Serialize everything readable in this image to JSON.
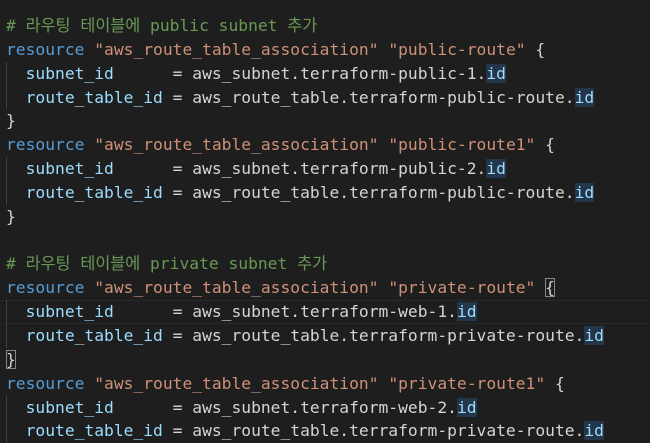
{
  "colors": {
    "background": "#1e1e1e",
    "comment": "#6a9955",
    "keyword": "#569cd6",
    "string": "#ce9178",
    "attribute": "#9cdcfe",
    "text": "#d4d4d4",
    "id_highlight": "#24364a"
  },
  "editor": {
    "lines": [
      {
        "tokens": [
          {
            "t": "comment",
            "v": "# 라우팅 테이블에 public subnet 추가"
          }
        ]
      },
      {
        "tokens": [
          {
            "t": "kw",
            "v": "resource"
          },
          {
            "t": "punc",
            "v": " "
          },
          {
            "t": "str",
            "v": "\"aws_route_table_association\""
          },
          {
            "t": "punc",
            "v": " "
          },
          {
            "t": "str",
            "v": "\"public-route\""
          },
          {
            "t": "punc",
            "v": " {"
          }
        ]
      },
      {
        "indent": true,
        "tokens": [
          {
            "t": "punc",
            "v": "  "
          },
          {
            "t": "attr",
            "v": "subnet_id"
          },
          {
            "t": "punc",
            "v": "      = "
          },
          {
            "t": "plain",
            "v": "aws_subnet.terraform-public-1."
          },
          {
            "t": "id",
            "v": "id"
          }
        ]
      },
      {
        "indent": true,
        "tokens": [
          {
            "t": "punc",
            "v": "  "
          },
          {
            "t": "attr",
            "v": "route_table_id"
          },
          {
            "t": "punc",
            "v": " = "
          },
          {
            "t": "plain",
            "v": "aws_route_table.terraform-public-route."
          },
          {
            "t": "id",
            "v": "id"
          }
        ]
      },
      {
        "tokens": [
          {
            "t": "punc",
            "v": "}"
          }
        ]
      },
      {
        "tokens": [
          {
            "t": "kw",
            "v": "resource"
          },
          {
            "t": "punc",
            "v": " "
          },
          {
            "t": "str",
            "v": "\"aws_route_table_association\""
          },
          {
            "t": "punc",
            "v": " "
          },
          {
            "t": "str",
            "v": "\"public-route1\""
          },
          {
            "t": "punc",
            "v": " {"
          }
        ]
      },
      {
        "indent": true,
        "tokens": [
          {
            "t": "punc",
            "v": "  "
          },
          {
            "t": "attr",
            "v": "subnet_id"
          },
          {
            "t": "punc",
            "v": "      = "
          },
          {
            "t": "plain",
            "v": "aws_subnet.terraform-public-2."
          },
          {
            "t": "id",
            "v": "id"
          }
        ]
      },
      {
        "indent": true,
        "tokens": [
          {
            "t": "punc",
            "v": "  "
          },
          {
            "t": "attr",
            "v": "route_table_id"
          },
          {
            "t": "punc",
            "v": " = "
          },
          {
            "t": "plain",
            "v": "aws_route_table.terraform-public-route."
          },
          {
            "t": "id",
            "v": "id"
          }
        ]
      },
      {
        "tokens": [
          {
            "t": "punc",
            "v": "}"
          }
        ]
      },
      {
        "tokens": []
      },
      {
        "tokens": [
          {
            "t": "comment",
            "v": "# 라우팅 테이블에 private subnet 추가"
          }
        ]
      },
      {
        "tokens": [
          {
            "t": "kw",
            "v": "resource"
          },
          {
            "t": "punc",
            "v": " "
          },
          {
            "t": "str",
            "v": "\"aws_route_table_association\""
          },
          {
            "t": "punc",
            "v": " "
          },
          {
            "t": "str",
            "v": "\"private-route\""
          },
          {
            "t": "punc",
            "v": " "
          },
          {
            "t": "bracket",
            "v": "{"
          }
        ]
      },
      {
        "indent": true,
        "current": true,
        "tokens": [
          {
            "t": "punc",
            "v": "  "
          },
          {
            "t": "attr",
            "v": "subnet_id"
          },
          {
            "t": "punc",
            "v": "      = "
          },
          {
            "t": "plain",
            "v": "aws_subnet.terraform-web-1."
          },
          {
            "t": "id",
            "v": "id"
          }
        ]
      },
      {
        "indent": true,
        "tokens": [
          {
            "t": "punc",
            "v": "  "
          },
          {
            "t": "attr",
            "v": "route_table_id"
          },
          {
            "t": "punc",
            "v": " = "
          },
          {
            "t": "plain",
            "v": "aws_route_table.terraform-private-route."
          },
          {
            "t": "id",
            "v": "id"
          }
        ]
      },
      {
        "tokens": [
          {
            "t": "bracket",
            "v": "}"
          }
        ]
      },
      {
        "tokens": [
          {
            "t": "kw",
            "v": "resource"
          },
          {
            "t": "punc",
            "v": " "
          },
          {
            "t": "str",
            "v": "\"aws_route_table_association\""
          },
          {
            "t": "punc",
            "v": " "
          },
          {
            "t": "str",
            "v": "\"private-route1\""
          },
          {
            "t": "punc",
            "v": " {"
          }
        ]
      },
      {
        "indent": true,
        "tokens": [
          {
            "t": "punc",
            "v": "  "
          },
          {
            "t": "attr",
            "v": "subnet_id"
          },
          {
            "t": "punc",
            "v": "      = "
          },
          {
            "t": "plain",
            "v": "aws_subnet.terraform-web-2."
          },
          {
            "t": "id",
            "v": "id"
          }
        ]
      },
      {
        "indent": true,
        "tokens": [
          {
            "t": "punc",
            "v": "  "
          },
          {
            "t": "attr",
            "v": "route_table_id"
          },
          {
            "t": "punc",
            "v": " = "
          },
          {
            "t": "plain",
            "v": "aws_route_table.terraform-private-route."
          },
          {
            "t": "id",
            "v": "id"
          }
        ]
      }
    ]
  }
}
